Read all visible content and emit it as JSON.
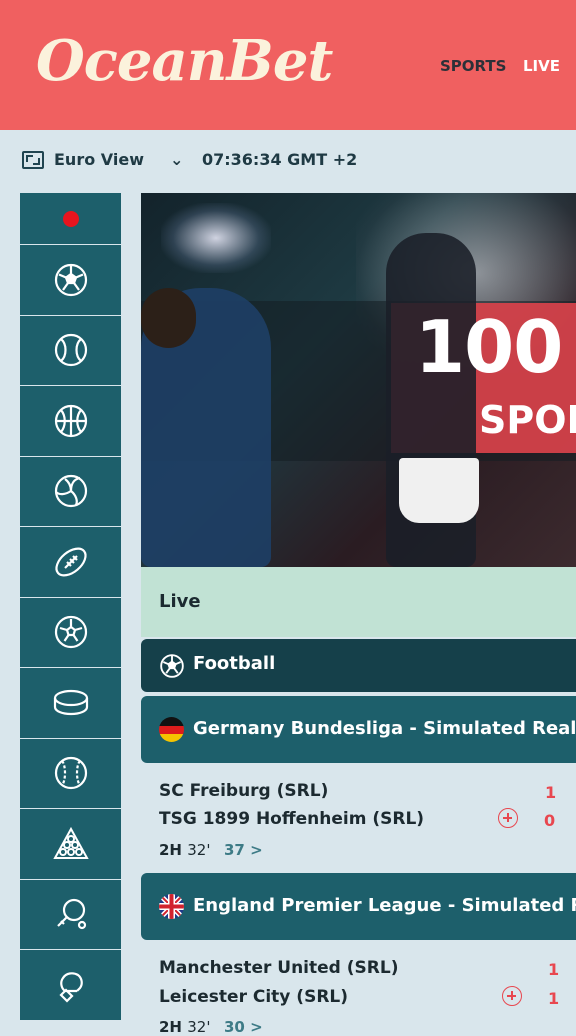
{
  "header": {
    "logo": "OceanBet",
    "nav": [
      "SPORTS",
      "LIVE"
    ]
  },
  "subbar": {
    "view_label": "Euro View",
    "chevron": "⌄",
    "clock": "07:36:34 GMT +2"
  },
  "sidebar": {
    "items": [
      {
        "icon": "live-dot-icon"
      },
      {
        "icon": "soccer-ball-icon"
      },
      {
        "icon": "tennis-ball-icon"
      },
      {
        "icon": "basketball-icon"
      },
      {
        "icon": "volleyball-icon"
      },
      {
        "icon": "american-football-icon"
      },
      {
        "icon": "futsal-ball-icon"
      },
      {
        "icon": "ice-hockey-puck-icon"
      },
      {
        "icon": "baseball-icon"
      },
      {
        "icon": "snooker-balls-icon"
      },
      {
        "icon": "table-tennis-icon"
      },
      {
        "icon": "boxing-glove-icon"
      }
    ],
    "active_color": "#e8141e"
  },
  "banner": {
    "headline": "100",
    "subline": "SPOR"
  },
  "live_section": {
    "title": "Live"
  },
  "sport": {
    "name": "Football",
    "icon": "soccer-ball-icon"
  },
  "leagues": [
    {
      "name": "Germany Bundesliga - Simulated Reality",
      "flag": "germany-flag-icon",
      "match": {
        "home": "SC Freiburg (SRL)",
        "away": "TSG 1899 Hoffenheim (SRL)",
        "home_score": "1",
        "away_score": "0",
        "period": "2H",
        "minute": "32'",
        "markets": "37 >"
      }
    },
    {
      "name": "England Premier League - Simulated Reality",
      "flag": "uk-flag-icon",
      "match": {
        "home": "Manchester United (SRL)",
        "away": "Leicester City (SRL)",
        "home_score": "1",
        "away_score": "1",
        "period": "2H",
        "minute": "32'",
        "markets": "30 >"
      }
    }
  ],
  "colors": {
    "header": "#f06060",
    "teal": "#1d5f6b",
    "dark_teal": "#15404a",
    "live_bar": "#c1e2d4",
    "score": "#e8474f"
  }
}
